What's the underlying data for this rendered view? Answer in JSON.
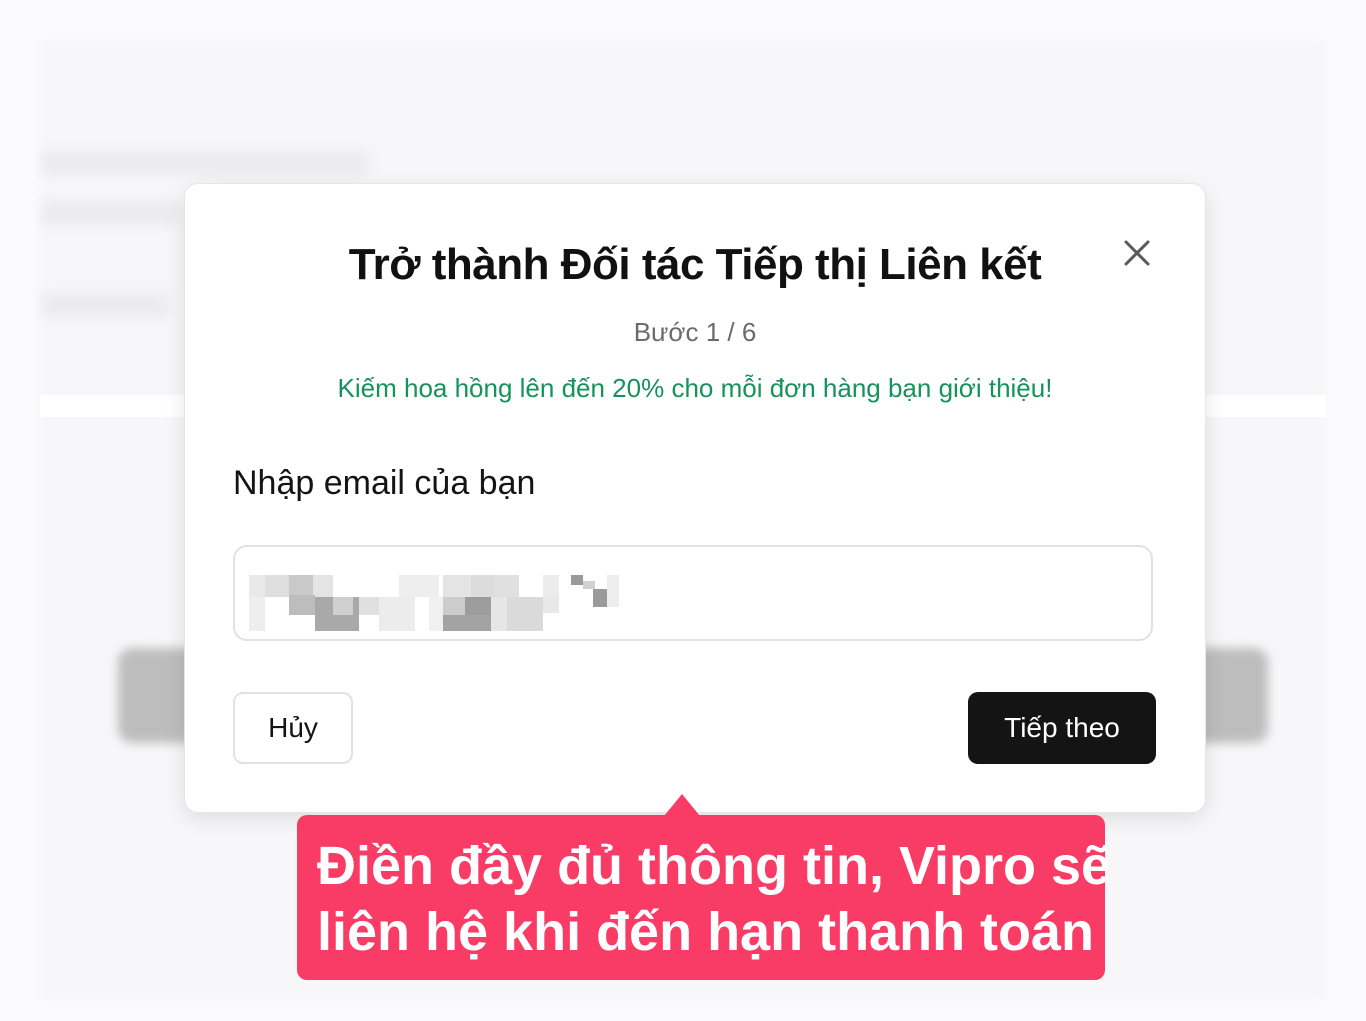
{
  "modal": {
    "title": "Trở thành Đối tác Tiếp thị Liên kết",
    "step": "Bước 1 / 6",
    "promo": "Kiếm hoa hồng lên đến 20% cho mỗi đơn hàng bạn giới thiệu!",
    "email_label": "Nhập email của bạn",
    "email_value_state": "pixelated (redacted)",
    "cancel_label": "Hủy",
    "next_label": "Tiếp theo",
    "close_icon": "close-icon"
  },
  "callout": {
    "line1": "Điền đầy đủ thông tin, Vipro sẽ",
    "line2": "liên hệ khi đến hạn thanh toán"
  },
  "colors": {
    "promo_green": "#16935d",
    "callout_pink": "#f93c65",
    "primary_button": "#141414"
  }
}
